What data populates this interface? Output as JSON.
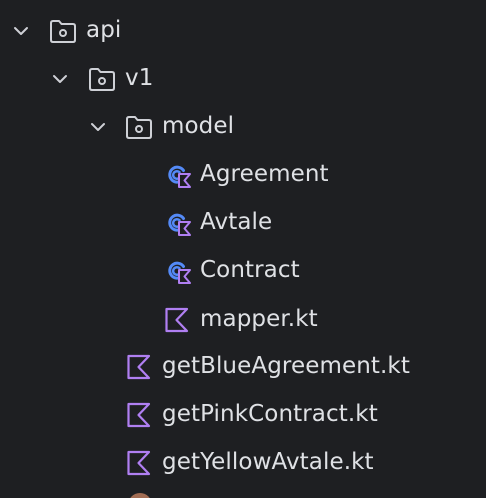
{
  "tree": {
    "items": [
      {
        "label": "api",
        "type": "folder",
        "expanded": true
      },
      {
        "label": "v1",
        "type": "folder",
        "expanded": true
      },
      {
        "label": "model",
        "type": "folder",
        "expanded": true
      },
      {
        "label": "Agreement",
        "type": "kotlin-class"
      },
      {
        "label": "Avtale",
        "type": "kotlin-class"
      },
      {
        "label": "Contract",
        "type": "kotlin-class"
      },
      {
        "label": "mapper.kt",
        "type": "kotlin-file"
      },
      {
        "label": "getBlueAgreement.kt",
        "type": "kotlin-file"
      },
      {
        "label": "getPinkContract.kt",
        "type": "kotlin-file"
      },
      {
        "label": "getYellowAvtale.kt",
        "type": "kotlin-file"
      }
    ]
  },
  "colors": {
    "background": "#1e1f22",
    "text": "#dfe1e5",
    "icon_gray": "#ced0d6",
    "kotlin_purple": "#b07ff2",
    "class_blue": "#548af7"
  }
}
